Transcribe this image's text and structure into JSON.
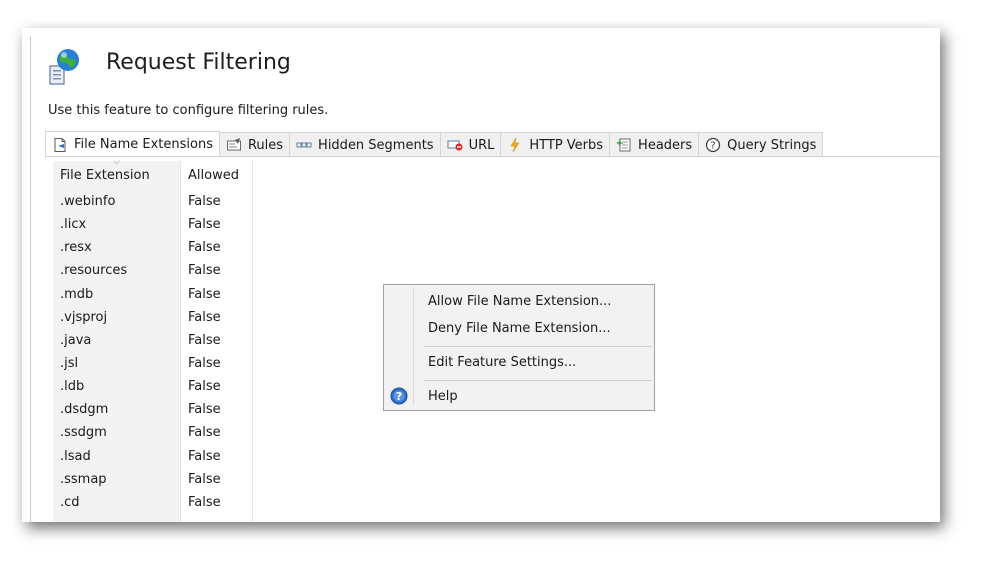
{
  "page": {
    "title": "Request Filtering",
    "description": "Use this feature to configure filtering rules."
  },
  "tabs": [
    {
      "label": "File Name Extensions",
      "icon": "file-extension-icon",
      "active": true
    },
    {
      "label": "Rules",
      "icon": "rules-icon"
    },
    {
      "label": "Hidden Segments",
      "icon": "hidden-segments-icon"
    },
    {
      "label": "URL",
      "icon": "url-icon"
    },
    {
      "label": "HTTP Verbs",
      "icon": "http-verbs-icon"
    },
    {
      "label": "Headers",
      "icon": "headers-icon"
    },
    {
      "label": "Query Strings",
      "icon": "query-strings-icon"
    }
  ],
  "grid": {
    "columns": [
      "File Extension",
      "Allowed"
    ],
    "rows": [
      {
        "ext": ".webinfo",
        "allowed": "False"
      },
      {
        "ext": ".licx",
        "allowed": "False"
      },
      {
        "ext": ".resx",
        "allowed": "False"
      },
      {
        "ext": ".resources",
        "allowed": "False"
      },
      {
        "ext": ".mdb",
        "allowed": "False"
      },
      {
        "ext": ".vjsproj",
        "allowed": "False"
      },
      {
        "ext": ".java",
        "allowed": "False"
      },
      {
        "ext": ".jsl",
        "allowed": "False"
      },
      {
        "ext": ".ldb",
        "allowed": "False"
      },
      {
        "ext": ".dsdgm",
        "allowed": "False"
      },
      {
        "ext": ".ssdgm",
        "allowed": "False"
      },
      {
        "ext": ".lsad",
        "allowed": "False"
      },
      {
        "ext": ".ssmap",
        "allowed": "False"
      },
      {
        "ext": ".cd",
        "allowed": "False"
      }
    ]
  },
  "context_menu": {
    "allow": "Allow File Name Extension...",
    "deny": "Deny File Name Extension...",
    "edit": "Edit Feature Settings...",
    "help": "Help"
  },
  "colors": {
    "grid_column_bg": "#f3f3f3",
    "menu_bg": "#f2f2f2",
    "help_icon": "#2f6fc9"
  }
}
